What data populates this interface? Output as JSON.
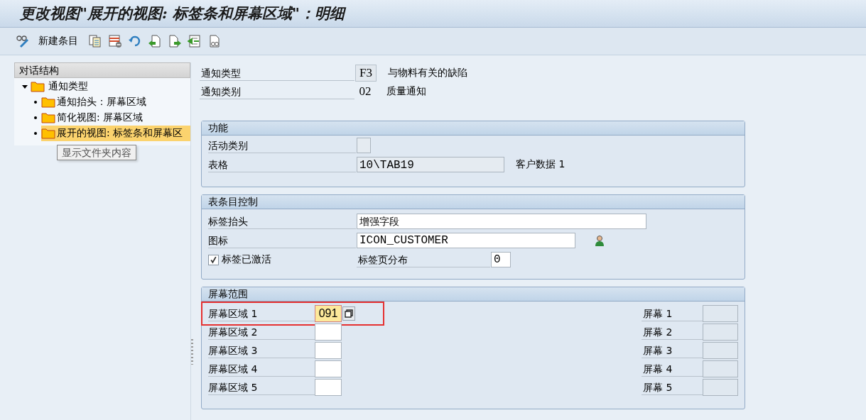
{
  "title": "更改视图\"展开的视图: 标签条和屏幕区域\"：明细",
  "toolbar": {
    "new_entries": "新建条目"
  },
  "tree": {
    "header": "对话结构",
    "items": [
      {
        "label": "通知类型",
        "expanded": true,
        "selected": false,
        "children": [
          {
            "label": "通知抬头：屏幕区域",
            "selected": false
          },
          {
            "label": "简化视图: 屏幕区域",
            "selected": false
          },
          {
            "label": "展开的视图: 标签条和屏幕区",
            "selected": true
          }
        ]
      }
    ]
  },
  "tooltip": "显示文件夹内容",
  "header_fields": [
    {
      "kind": "box",
      "label": "通知类型",
      "value": "F3",
      "description": "与物料有关的缺陷"
    },
    {
      "kind": "plain",
      "label": "通知类别",
      "value": "02",
      "description": "质量通知"
    }
  ],
  "function_group": {
    "title": "功能",
    "activity_category": {
      "label": "活动类别"
    },
    "table": {
      "label": "表格",
      "value": "10\\TAB19",
      "note": "客户数据 1"
    }
  },
  "tab_control": {
    "title": "表条目控制",
    "tab_title": {
      "label": "标签抬头",
      "value": "增强字段"
    },
    "icon": {
      "label": "图标",
      "value": "ICON_CUSTOMER"
    },
    "tab_active": {
      "label": "标签已激活",
      "checked": true
    },
    "tab_distribution": {
      "label": "标签页分布",
      "value": "0"
    }
  },
  "screen_range": {
    "title": "屏幕范围",
    "areas": [
      {
        "label": "屏幕区域 1",
        "value": "091",
        "focused": true,
        "marked": true
      },
      {
        "label": "屏幕区域 2",
        "focused": false,
        "marked": false
      },
      {
        "label": "屏幕区域 3",
        "focused": false,
        "marked": false
      },
      {
        "label": "屏幕区域 4",
        "focused": false,
        "marked": false
      },
      {
        "label": "屏幕区域 5",
        "focused": false,
        "marked": false
      }
    ],
    "screens": [
      {
        "label": "屏幕 1"
      },
      {
        "label": "屏幕 2"
      },
      {
        "label": "屏幕 3"
      },
      {
        "label": "屏幕 4"
      },
      {
        "label": "屏幕 5"
      }
    ]
  }
}
